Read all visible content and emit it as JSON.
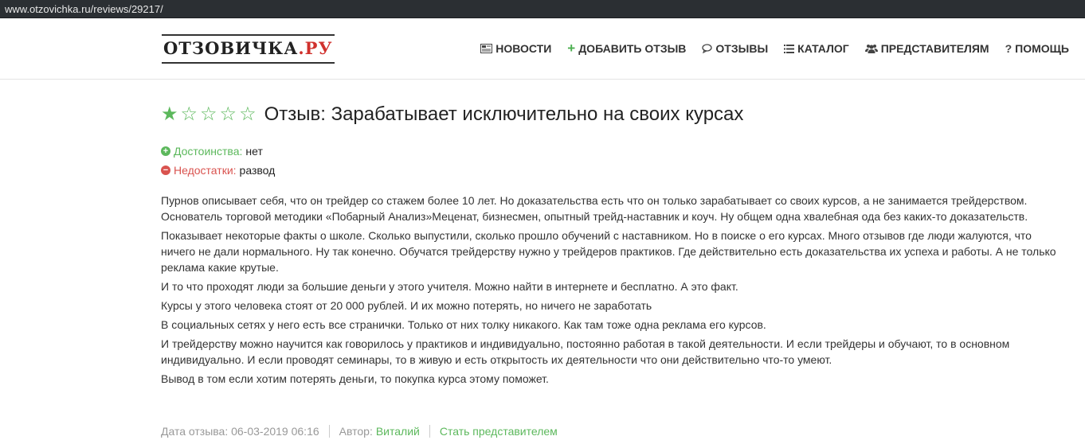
{
  "browser": {
    "url": "www.otzovichka.ru/reviews/29217/"
  },
  "header": {
    "logo_main": "ОТЗОВИЧКА",
    "logo_tld": ".РУ",
    "nav": [
      {
        "label": "НОВОСТИ",
        "icon": "newspaper-icon"
      },
      {
        "label": "ДОБАВИТЬ ОТЗЫВ",
        "icon": "plus-icon"
      },
      {
        "label": "ОТЗЫВЫ",
        "icon": "comment-icon"
      },
      {
        "label": "КАТАЛОГ",
        "icon": "list-icon"
      },
      {
        "label": "ПРЕДСТАВИТЕЛЯМ",
        "icon": "users-icon"
      },
      {
        "label": "ПОМОЩЬ",
        "icon": "question-icon"
      }
    ]
  },
  "review": {
    "rating": 1,
    "rating_max": 5,
    "title": "Отзыв: Зарабатывает исключительно на своих курсах",
    "pros_label": "Достоинства:",
    "pros_value": "нет",
    "cons_label": "Недостатки:",
    "cons_value": "развод",
    "paragraphs": [
      "Пурнов описывает себя, что он трейдер со стажем более 10 лет. Но доказательства есть что он только зарабатывает со своих курсов, а не занимается трейдерством. Основатель торговой методики «Побарный Анализ»Меценат, бизнесмен, опытный трейд-наставник и коуч. Ну общем одна хвалебная ода без каких-то доказательств.",
      "Показывает некоторые факты о школе. Сколько выпустили, сколько прошло обучений с наставником. Но в поиске о его курсах. Много отзывов где люди жалуются, что ничего не дали нормального. Ну так конечно. Обучатся трейдерству нужно у трейдеров практиков. Где действительно есть доказательства их успеха и работы. А не только реклама какие крутые.",
      "И то что проходят люди за большие деньги у этого учителя. Можно найти в интернете и бесплатно. А это факт.",
      "Курсы у этого человека стоят от 20 000 рублей. И их можно потерять, но ничего не заработать",
      "В социальных сетях у него есть все странички. Только от них толку никакого. Как там тоже одна реклама его курсов.",
      "И трейдерству можно научится как говорилось у практиков и индивидуально, постоянно работая в такой деятельности. И если трейдеры и обучают, то в основном индивидуально. И если проводят семинары, то в живую и есть открытость их деятельности что они действительно что-то умеют.",
      "Вывод в том если хотим потерять деньги, то покупка курса этому поможет."
    ],
    "meta": {
      "date_text": "Дата отзыва: 06-03-2019 06:16",
      "author_label": "Автор:",
      "author_name": "Виталий",
      "become_rep": "Стать представителем"
    }
  },
  "colors": {
    "accent_green": "#5cb85c",
    "accent_red": "#d9534f",
    "logo_red": "#d0312d"
  }
}
